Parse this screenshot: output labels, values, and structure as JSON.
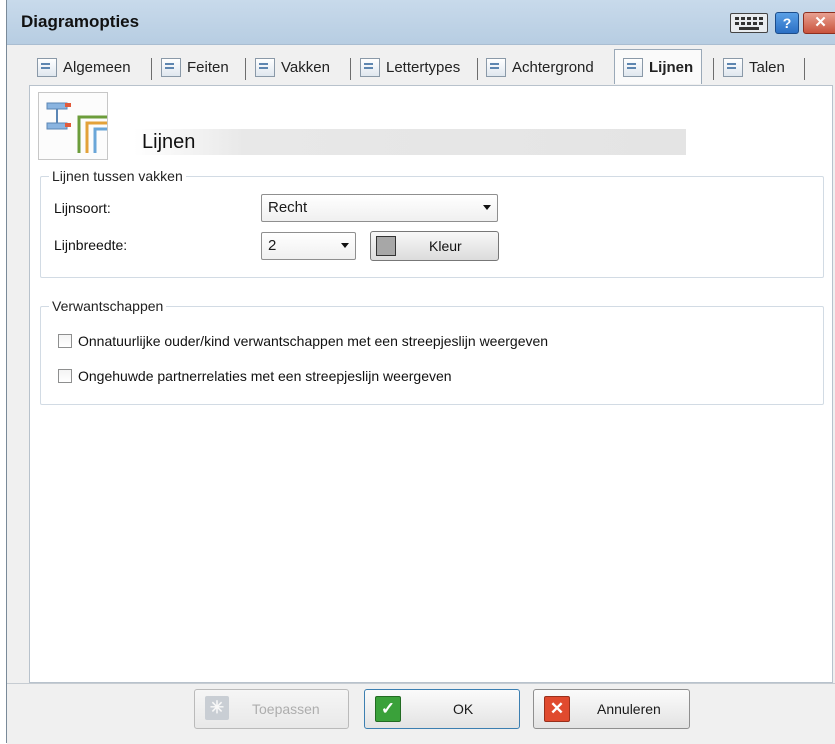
{
  "window": {
    "title": "Diagramopties",
    "help_label": "?",
    "close_label": "✕",
    "colors": {
      "titlebar": "#c1d5e9",
      "close": "#c9533d",
      "help": "#2b6fc4"
    }
  },
  "tabs": [
    {
      "label": "Algemeen",
      "icon": "settings-page-icon",
      "active": false
    },
    {
      "label": "Feiten",
      "icon": "facts-page-icon",
      "active": false
    },
    {
      "label": "Vakken",
      "icon": "boxes-page-icon",
      "active": false
    },
    {
      "label": "Lettertypes",
      "icon": "font-page-icon",
      "active": false
    },
    {
      "label": "Achtergrond",
      "icon": "background-page-icon",
      "active": false
    },
    {
      "label": "Lijnen",
      "icon": "lines-page-icon",
      "active": true
    },
    {
      "label": "Talen",
      "icon": "languages-page-icon",
      "active": false
    }
  ],
  "page": {
    "title": "Lijnen",
    "icon": "lines-diagram-icon"
  },
  "lines_group": {
    "legend": "Lijnen tussen vakken",
    "line_type_label": "Lijnsoort:",
    "line_type_value": "Recht",
    "line_width_label": "Lijnbreedte:",
    "line_width_value": "2",
    "color_button_label": "Kleur",
    "color_swatch": "#a7a7a7"
  },
  "relations_group": {
    "legend": "Verwantschappen",
    "option1_label": "Onnatuurlijke ouder/kind verwantschappen met een streepjeslijn weergeven",
    "option1_checked": false,
    "option2_label": "Ongehuwde partnerrelaties met een streepjeslijn weergeven",
    "option2_checked": false
  },
  "footer": {
    "apply_label": "Toepassen",
    "ok_label": "OK",
    "cancel_label": "Annuleren",
    "ok_icon": "check-icon",
    "cancel_icon": "x-icon",
    "apply_icon": "apply-icon"
  }
}
